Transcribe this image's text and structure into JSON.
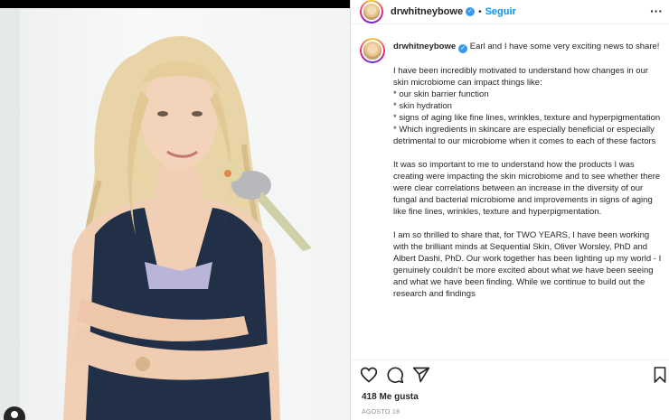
{
  "post": {
    "username": "drwhitneybowe",
    "verified_mark": "✓",
    "separator": "•",
    "follow_label": "Seguir",
    "more_label": "···",
    "caption_username": "drwhitneybowe",
    "caption_body": " Earl and I have some very exciting news to share!\n\nI have been incredibly motivated to understand how changes in our skin microbiome can impact things like:\n* our skin barrier function\n* skin hydration\n* signs of aging like fine lines, wrinkles, texture and hyperpigmentation\n* Which ingredients in skincare are especially beneficial or especially detrimental to our microbiome when it comes to each of these factors\n\nIt was so important to me to understand how the products I was creating were impacting the skin microbiome and to see whether there were clear correlations between an increase in the diversity of our fungal and bacterial microbiome and improvements in signs of aging like fine lines, wrinkles, texture and hyperpigmentation.\n\nI am so thrilled to share that, for TWO YEARS, I have been working with the brilliant minds at Sequential Skin, Oliver Worsley, PhD and Albert Dashi, PhD. Our work together has been lighting up my world - I genuinely couldn't be more excited about what we have been seeing and what we have been finding. While we continue to build out the research and findings",
    "likes_text": "418 Me gusta",
    "date_text": "AGOSTO 18"
  },
  "icons": {
    "like": "heart-icon",
    "comment": "comment-icon",
    "share": "share-icon",
    "save": "bookmark-icon",
    "profile": "user-icon"
  },
  "colors": {
    "link_blue": "#0095f6",
    "verified_blue": "#3897f0",
    "text": "#262626",
    "muted": "#8e8e8e"
  }
}
